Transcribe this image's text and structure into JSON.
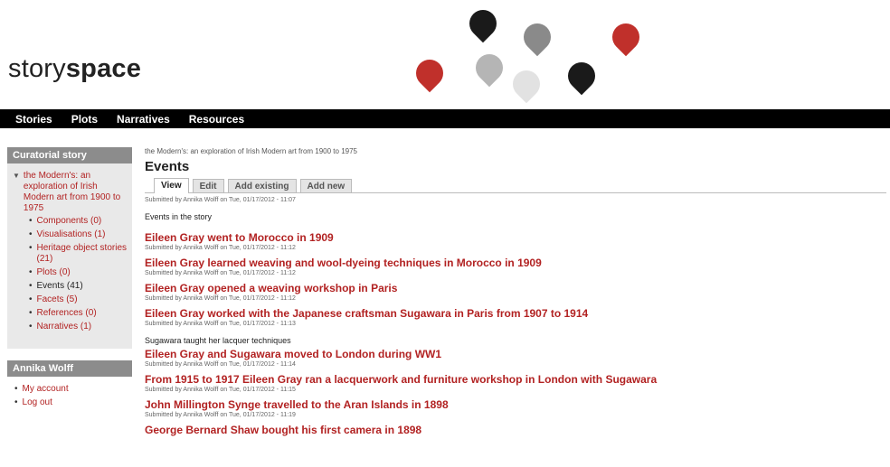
{
  "site": {
    "logo_light": "story",
    "logo_bold": "space",
    "pins": [
      {
        "color": "#1a1a1a"
      },
      {
        "color": "#8a8a8a"
      },
      {
        "color": "#c0302b"
      },
      {
        "color": "#c0302b"
      },
      {
        "color": "#b5b5b5"
      },
      {
        "color": "#e2e2e2"
      },
      {
        "color": "#1a1a1a"
      }
    ]
  },
  "nav": [
    "Stories",
    "Plots",
    "Narratives",
    "Resources"
  ],
  "sidebar": {
    "curatorial": {
      "title": "Curatorial story",
      "root": "the Modern's: an exploration of Irish Modern art from 1900 to 1975",
      "items": [
        {
          "label": "Components (0)",
          "active": false
        },
        {
          "label": "Visualisations (1)",
          "active": false
        },
        {
          "label": "Heritage object stories (21)",
          "active": false
        },
        {
          "label": "Plots (0)",
          "active": false
        },
        {
          "label": "Events (41)",
          "active": true
        },
        {
          "label": "Facets (5)",
          "active": false
        },
        {
          "label": "References (0)",
          "active": false
        },
        {
          "label": "Narratives (1)",
          "active": false
        }
      ]
    },
    "user": {
      "title": "Annika Wolff",
      "items": [
        "My account",
        "Log out"
      ]
    }
  },
  "main": {
    "breadcrumb": "the Modern's: an exploration of Irish Modern art from 1900 to 1975",
    "title": "Events",
    "tabs": [
      {
        "label": "View",
        "active": true
      },
      {
        "label": "Edit",
        "active": false
      },
      {
        "label": "Add existing",
        "active": false
      },
      {
        "label": "Add new",
        "active": false
      }
    ],
    "submitted": "Submitted by Annika Wolff on Tue, 01/17/2012 - 11:07",
    "description": "Events in the story",
    "items": [
      {
        "title": "Eileen Gray went to Morocco in 1909",
        "meta": "Submitted by Annika Wolff on Tue, 01/17/2012 - 11:12",
        "desc": ""
      },
      {
        "title": "Eileen Gray learned weaving and wool-dyeing techniques in Morocco in 1909",
        "meta": "Submitted by Annika Wolff on Tue, 01/17/2012 - 11:12",
        "desc": ""
      },
      {
        "title": "Eileen Gray opened a weaving workshop in Paris",
        "meta": "Submitted by Annika Wolff on Tue, 01/17/2012 - 11:12",
        "desc": ""
      },
      {
        "title": "Eileen Gray worked with the Japanese craftsman Sugawara in Paris from 1907 to 1914",
        "meta": "Submitted by Annika Wolff on Tue, 01/17/2012 - 11:13",
        "desc": "Sugawara taught her lacquer techniques"
      },
      {
        "title": "Eileen Gray and Sugawara moved to London during WW1",
        "meta": "Submitted by Annika Wolff on Tue, 01/17/2012 - 11:14",
        "desc": ""
      },
      {
        "title": "From 1915 to 1917 Eileen Gray ran a lacquerwork and furniture workshop in London with Sugawara",
        "meta": "Submitted by Annika Wolff on Tue, 01/17/2012 - 11:15",
        "desc": ""
      },
      {
        "title": "John Millington Synge travelled to the Aran Islands in 1898",
        "meta": "Submitted by Annika Wolff on Tue, 01/17/2012 - 11:19",
        "desc": ""
      },
      {
        "title": "George Bernard Shaw bought his first camera in 1898",
        "meta": "",
        "desc": ""
      }
    ]
  }
}
